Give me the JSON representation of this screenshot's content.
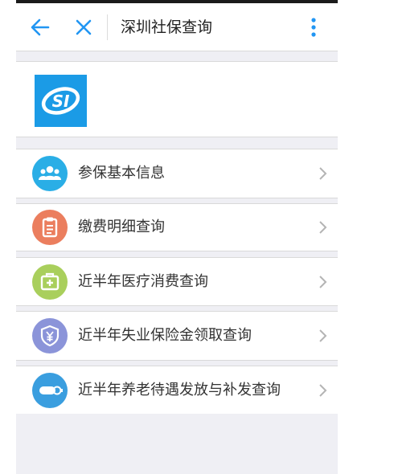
{
  "header": {
    "title": "深圳社保查询",
    "back_icon": "arrow-left-icon",
    "close_icon": "close-icon",
    "more_icon": "more-vertical-icon"
  },
  "brand": {
    "logo_text": "SI",
    "logo_color": "#1b9be6"
  },
  "menu": {
    "items": [
      {
        "label": "参保基本信息",
        "icon": "people-icon",
        "color": "#2aaee6"
      },
      {
        "label": "缴费明细查询",
        "icon": "clipboard-icon",
        "color": "#eb7e5e"
      },
      {
        "label": "近半年医疗消费查询",
        "icon": "medical-kit-icon",
        "color": "#a9cf5c"
      },
      {
        "label": "近半年失业保险金领取查询",
        "icon": "shield-yen-icon",
        "color": "#8b94d9"
      },
      {
        "label": "近半年养老待遇发放与补发查询",
        "icon": "pension-card-icon",
        "color": "#3a9edf"
      }
    ]
  },
  "colors": {
    "accent": "#2196f3",
    "background": "#efeff4",
    "chevron": "#b4b4b4"
  }
}
